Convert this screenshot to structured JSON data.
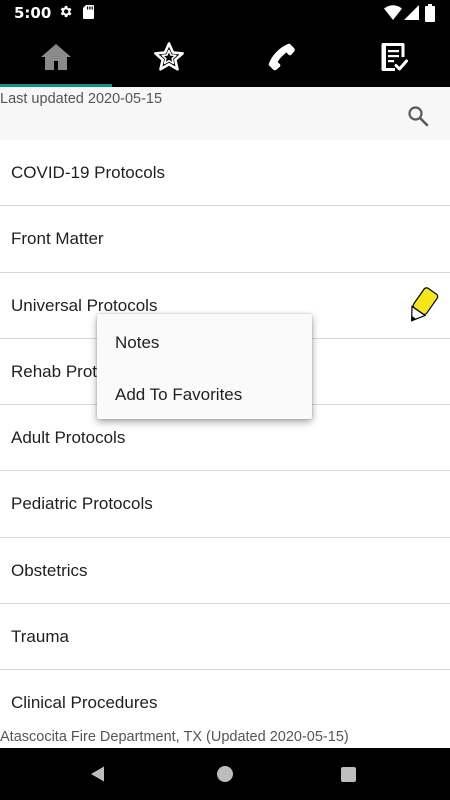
{
  "status_bar": {
    "time": "5:00",
    "icons": [
      "gear-icon",
      "sd-card-icon",
      "wifi-icon",
      "signal-icon",
      "battery-icon"
    ]
  },
  "tabs": [
    {
      "name": "home",
      "icon": "home-icon",
      "selected": true
    },
    {
      "name": "favorites",
      "icon": "star-icon",
      "selected": false
    },
    {
      "name": "contacts",
      "icon": "phone-icon",
      "selected": false
    },
    {
      "name": "checklist",
      "icon": "checklist-icon",
      "selected": false
    }
  ],
  "header": {
    "last_updated": "Last updated 2020-05-15",
    "search_icon": "search-icon"
  },
  "list": {
    "items": [
      {
        "label": "COVID-19 Protocols"
      },
      {
        "label": "Front Matter"
      },
      {
        "label": "Universal Protocols",
        "has_note": true
      },
      {
        "label": "Rehab Protocols"
      },
      {
        "label": "Adult Protocols"
      },
      {
        "label": "Pediatric Protocols"
      },
      {
        "label": "Obstetrics"
      },
      {
        "label": "Trauma"
      },
      {
        "label": "Clinical Procedures"
      }
    ]
  },
  "context_menu": {
    "items": [
      {
        "label": "Notes"
      },
      {
        "label": "Add To Favorites"
      }
    ]
  },
  "footer": {
    "text": "Atascocita Fire Department, TX (Updated 2020-05-15)"
  },
  "colors": {
    "tab_indicator": "#1a8f8a",
    "note_pencil": "#f5e61a"
  }
}
